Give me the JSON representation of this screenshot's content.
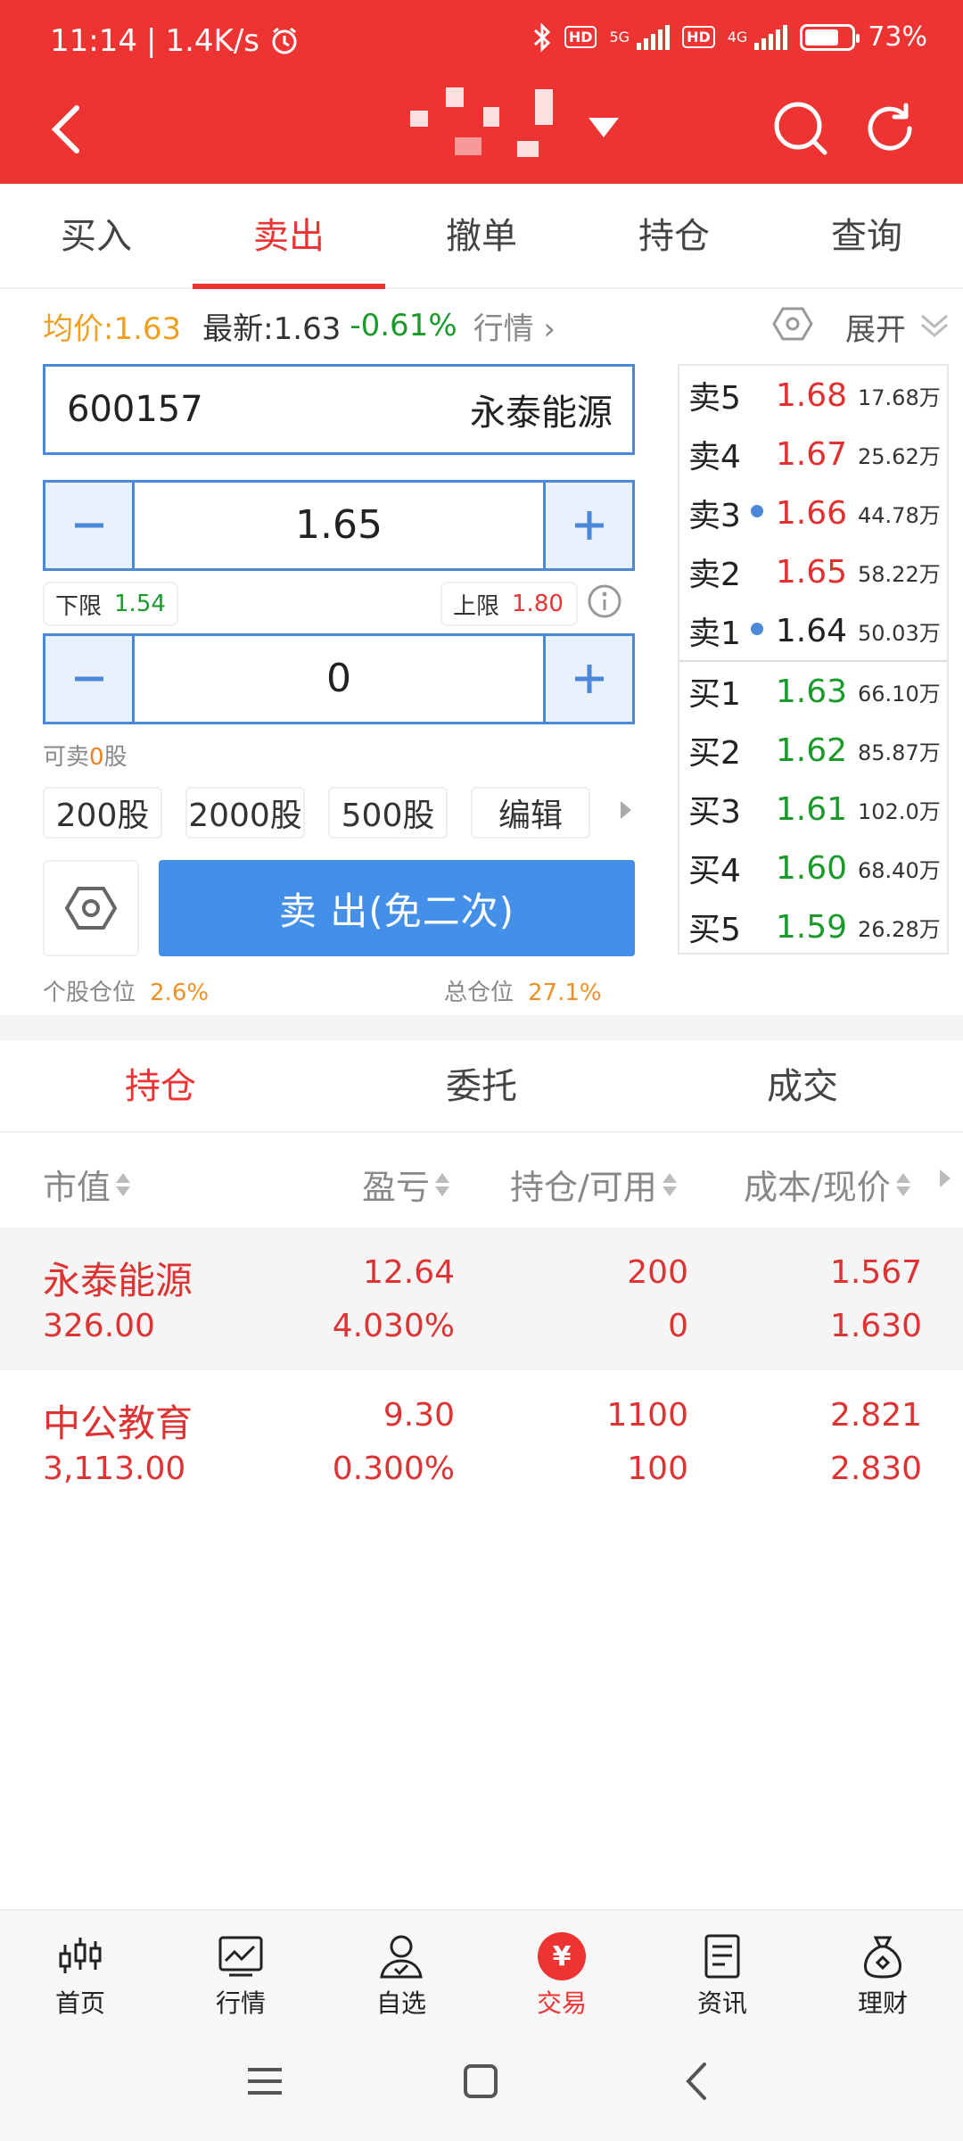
{
  "status_bar": {
    "time": "11:14",
    "speed": "1.4K/s",
    "network1": "5G",
    "network2": "4G",
    "hd": "HD",
    "battery": "73%",
    "battery_level": 0.73
  },
  "header": {
    "icons": [
      "back-icon",
      "search-icon",
      "refresh-icon",
      "dropdown-icon"
    ]
  },
  "tabs": [
    "买入",
    "卖出",
    "撤单",
    "持仓",
    "查询"
  ],
  "active_tab": 1,
  "quote": {
    "avg_label": "均价:1.63",
    "latest_label": "最新:1.63",
    "change_pct": "-0.61%",
    "market_link": "行情",
    "expand_label": "展开"
  },
  "form": {
    "stock_code": "600157",
    "stock_name": "永泰能源",
    "price": "1.65",
    "lower_limit_label": "下限",
    "lower_limit": "1.54",
    "upper_limit_label": "上限",
    "upper_limit": "1.80",
    "quantity": "0",
    "sellable_prefix": "可卖",
    "sellable_count": "0",
    "sellable_suffix": "股",
    "quick_qty": [
      "200股",
      "2000股",
      "500股",
      "编辑"
    ],
    "sell_button": "卖  出(免二次)",
    "stock_position_label": "个股仓位",
    "stock_position": "2.6%",
    "total_position_label": "总仓位",
    "total_position": "27.1%"
  },
  "order_book": {
    "asks": [
      {
        "label": "卖5",
        "price": "1.68",
        "volume": "17.68万",
        "dot": false
      },
      {
        "label": "卖4",
        "price": "1.67",
        "volume": "25.62万",
        "dot": false
      },
      {
        "label": "卖3",
        "price": "1.66",
        "volume": "44.78万",
        "dot": true
      },
      {
        "label": "卖2",
        "price": "1.65",
        "volume": "58.22万",
        "dot": false
      },
      {
        "label": "卖1",
        "price": "1.64",
        "volume": "50.03万",
        "dot": true
      }
    ],
    "bids": [
      {
        "label": "买1",
        "price": "1.63",
        "volume": "66.10万"
      },
      {
        "label": "买2",
        "price": "1.62",
        "volume": "85.87万"
      },
      {
        "label": "买3",
        "price": "1.61",
        "volume": "102.0万"
      },
      {
        "label": "买4",
        "price": "1.60",
        "volume": "68.40万"
      },
      {
        "label": "买5",
        "price": "1.59",
        "volume": "26.28万"
      }
    ],
    "colors": {
      "ask": "#e03030",
      "bid": "#1a9a2a",
      "neutral": "#222222"
    }
  },
  "holdings_tabs": [
    "持仓",
    "委托",
    "成交"
  ],
  "holdings_header": [
    "市值",
    "盈亏",
    "持仓/可用",
    "成本/现价"
  ],
  "holdings": [
    {
      "name": "永泰能源",
      "market_value": "326.00",
      "pnl": "12.64",
      "pnl_pct": "4.030%",
      "position": "200",
      "available": "0",
      "cost": "1.567",
      "current": "1.630"
    },
    {
      "name": "中公教育",
      "market_value": "3,113.00",
      "pnl": "9.30",
      "pnl_pct": "0.300%",
      "position": "1100",
      "available": "100",
      "cost": "2.821",
      "current": "2.830"
    }
  ],
  "bottom_nav": [
    "首页",
    "行情",
    "自选",
    "交易",
    "资讯",
    "理财"
  ],
  "bottom_nav_active": 3,
  "trade_icon_glyph": "¥",
  "theme": {
    "brand_red": "#ee3333",
    "accent_blue": "#4490e8"
  }
}
